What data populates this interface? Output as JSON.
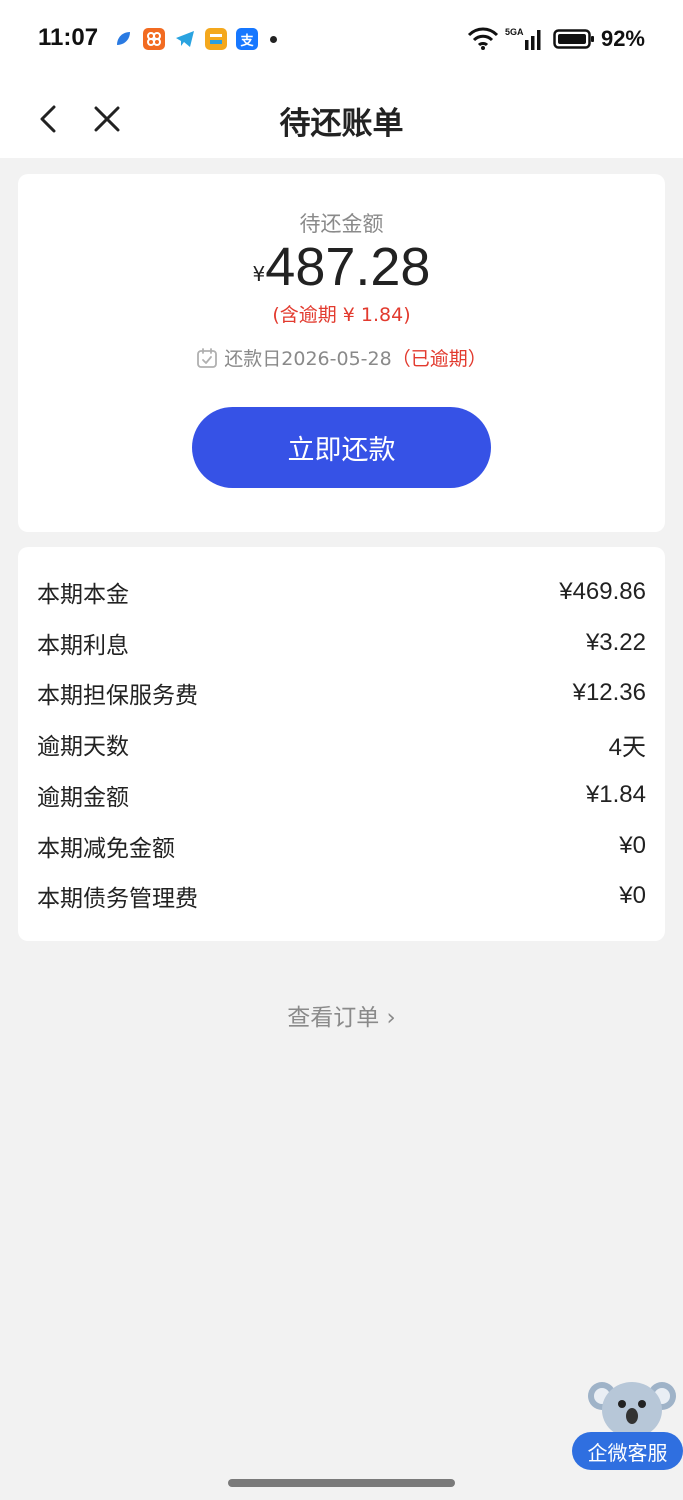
{
  "status_bar": {
    "time": "11:07",
    "battery_percent": "92%",
    "app_icons": [
      "app-blue-icon",
      "app-orange-icon",
      "telegram-icon",
      "app-yellow-icon",
      "alipay-icon"
    ],
    "alipay_glyph": "支"
  },
  "nav": {
    "title": "待还账单"
  },
  "summary": {
    "amount_label": "待还金额",
    "currency": "¥",
    "amount": "487.28",
    "overdue_note": "(含逾期 ¥ 1.84)",
    "due_prefix": "还款日2026-05-28",
    "due_status": "（已逾期）",
    "pay_button": "立即还款"
  },
  "details": [
    {
      "label": "本期本金",
      "value": "¥469.86"
    },
    {
      "label": "本期利息",
      "value": "¥3.22"
    },
    {
      "label": "本期担保服务费",
      "value": "¥12.36"
    },
    {
      "label": "逾期天数",
      "value": "4天"
    },
    {
      "label": "逾期金额",
      "value": "¥1.84"
    },
    {
      "label": "本期减免金额",
      "value": "¥0"
    },
    {
      "label": "本期债务管理费",
      "value": "¥0"
    }
  ],
  "view_order": "查看订单 ›",
  "customer_service": {
    "label": "企微客服"
  },
  "colors": {
    "primary": "#3652e6",
    "overdue": "#e23a2e",
    "background": "#f2f2f2"
  }
}
